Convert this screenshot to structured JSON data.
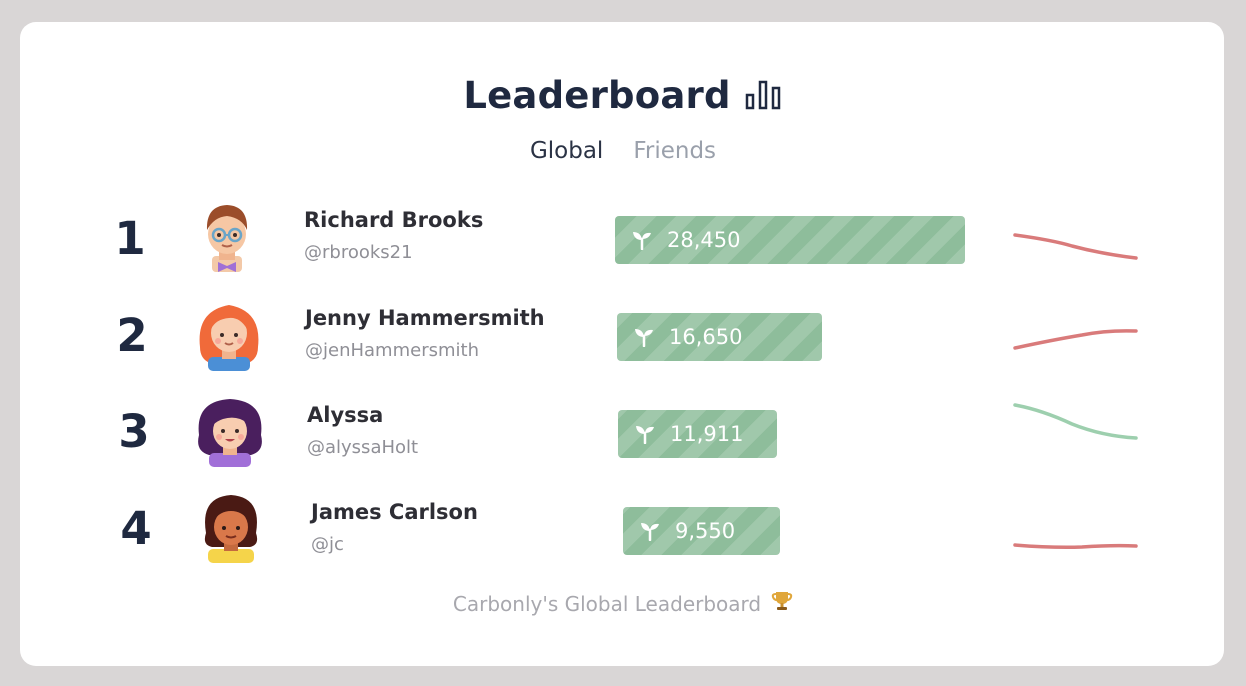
{
  "header": {
    "title": "Leaderboard",
    "title_icon": "bar-chart-icon"
  },
  "tabs": [
    {
      "label": "Global",
      "active": true
    },
    {
      "label": "Friends",
      "active": false
    }
  ],
  "entries": [
    {
      "rank": "1",
      "name": "Richard Brooks",
      "handle": "@rbrooks21",
      "score": "28,450",
      "score_value": 28450,
      "trend": "down",
      "trend_color": "#d97b7b",
      "avatar": "boy-glasses-avatar"
    },
    {
      "rank": "2",
      "name": "Jenny Hammersmith",
      "handle": "@jenHammersmith",
      "score": "16,650",
      "score_value": 16650,
      "trend": "up",
      "trend_color": "#d97b7b",
      "avatar": "girl-red-hair-avatar"
    },
    {
      "rank": "3",
      "name": "Alyssa",
      "handle": "@alyssaHolt",
      "score": "11,911",
      "score_value": 11911,
      "trend": "down",
      "trend_color": "#9dcfae",
      "avatar": "girl-purple-hair-avatar"
    },
    {
      "rank": "4",
      "name": "James Carlson",
      "handle": "@jc",
      "score": "9,550",
      "score_value": 9550,
      "trend": "flat",
      "trend_color": "#d97b7b",
      "avatar": "boy-curly-hair-avatar"
    }
  ],
  "score_icon": "sprout-icon",
  "footer": {
    "text": "Carbonly's Global Leaderboard",
    "icon": "trophy-icon"
  },
  "colors": {
    "bar": "#8ebd9b",
    "title": "#1f2940",
    "trend_negative": "#d97b7b",
    "trend_positive": "#9dcfae"
  }
}
